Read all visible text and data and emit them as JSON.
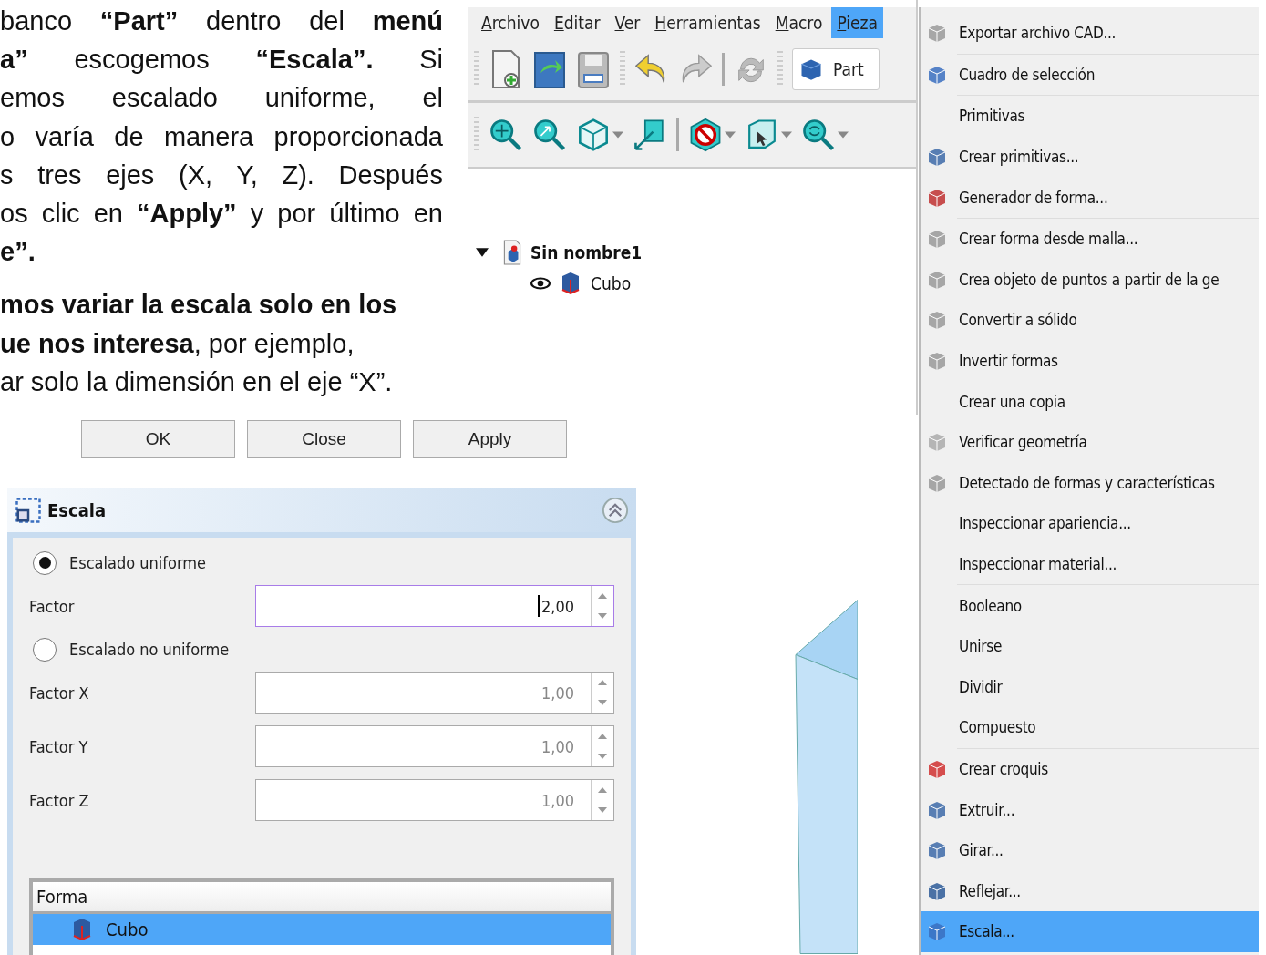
{
  "document": {
    "paragraphs": [
      {
        "lines": [
          "banco **“Part”** dentro del **menú**",
          "**a”** escogemos **“Escala”.** Si",
          "emos escalado uniforme, el",
          "o varía de manera proporcionada",
          "s tres ejes (X, Y, Z). Después",
          "os clic en **“Apply”** y por último en",
          "**e”.**"
        ]
      },
      {
        "lines": [
          "**mos variar la escala solo en los**",
          "**ue nos interesa**, por ejemplo,",
          "ar solo la dimensión en el eje “X”."
        ]
      }
    ]
  },
  "dialog_buttons": [
    "OK",
    "Close",
    "Apply"
  ],
  "app": {
    "menubar": [
      {
        "label": "Archivo",
        "selected": false
      },
      {
        "label": "Editar",
        "selected": false
      },
      {
        "label": "Ver",
        "selected": false
      },
      {
        "label": "Herramientas",
        "selected": false
      },
      {
        "label": "Macro",
        "selected": false
      },
      {
        "label": "Pieza",
        "selected": true
      }
    ],
    "workbench_selector": "Part",
    "tree": [
      {
        "label": "Sin nombre1",
        "expanded": true,
        "children": [
          {
            "label": "Cubo",
            "visible": true
          }
        ]
      }
    ]
  },
  "task_panel": {
    "title": "Escala",
    "options": [
      {
        "label": "Escalado uniforme",
        "selected": true,
        "fields": [
          {
            "label": "Factor",
            "value": "2,00",
            "focused": true,
            "disabled": false
          }
        ]
      },
      {
        "label": "Escalado no uniforme",
        "selected": false,
        "fields": [
          {
            "label": "Factor X",
            "value": "1,00",
            "focused": false,
            "disabled": true
          },
          {
            "label": "Factor Y",
            "value": "1,00",
            "focused": false,
            "disabled": true
          },
          {
            "label": "Factor Z",
            "value": "1,00",
            "focused": false,
            "disabled": true
          }
        ]
      }
    ],
    "shape_list": {
      "header": "Forma",
      "rows": [
        {
          "label": "Cubo",
          "selected": true
        }
      ]
    }
  },
  "menu": {
    "items": [
      {
        "label": "Exportar archivo CAD...",
        "has_icon": true,
        "separator_after": true,
        "selected": false
      },
      {
        "label": "Cuadro de selección",
        "has_icon": true,
        "separator_after": true,
        "selected": false
      },
      {
        "label": "Primitivas",
        "has_icon": false,
        "separator_after": false,
        "selected": false
      },
      {
        "label": "Crear primitivas...",
        "has_icon": true,
        "separator_after": false,
        "selected": false
      },
      {
        "label": "Generador de forma...",
        "has_icon": true,
        "separator_after": true,
        "selected": false
      },
      {
        "label": "Crear forma desde malla...",
        "has_icon": true,
        "separator_after": false,
        "selected": false
      },
      {
        "label": "Crea objeto de puntos a partir de la ge",
        "has_icon": true,
        "separator_after": false,
        "selected": false
      },
      {
        "label": "Convertir a sólido",
        "has_icon": true,
        "separator_after": false,
        "selected": false
      },
      {
        "label": "Invertir formas",
        "has_icon": true,
        "separator_after": false,
        "selected": false
      },
      {
        "label": "Crear una copia",
        "has_icon": false,
        "separator_after": false,
        "selected": false
      },
      {
        "label": "Verificar geometría",
        "has_icon": true,
        "separator_after": false,
        "selected": false
      },
      {
        "label": "Detectado de formas y características",
        "has_icon": true,
        "separator_after": false,
        "selected": false
      },
      {
        "label": "Inspeccionar apariencia...",
        "has_icon": false,
        "separator_after": false,
        "selected": false
      },
      {
        "label": "Inspeccionar material...",
        "has_icon": false,
        "separator_after": true,
        "selected": false
      },
      {
        "label": "Booleano",
        "has_icon": false,
        "separator_after": false,
        "selected": false
      },
      {
        "label": "Unirse",
        "has_icon": false,
        "separator_after": false,
        "selected": false
      },
      {
        "label": "Dividir",
        "has_icon": false,
        "separator_after": false,
        "selected": false
      },
      {
        "label": "Compuesto",
        "has_icon": false,
        "separator_after": true,
        "selected": false
      },
      {
        "label": "Crear croquis",
        "has_icon": true,
        "separator_after": false,
        "selected": false
      },
      {
        "label": "Extruir...",
        "has_icon": true,
        "separator_after": false,
        "selected": false
      },
      {
        "label": "Girar...",
        "has_icon": true,
        "separator_after": false,
        "selected": false
      },
      {
        "label": "Reflejar...",
        "has_icon": true,
        "separator_after": false,
        "selected": false
      },
      {
        "label": "Escala...",
        "has_icon": true,
        "separator_after": false,
        "selected": true
      }
    ]
  }
}
